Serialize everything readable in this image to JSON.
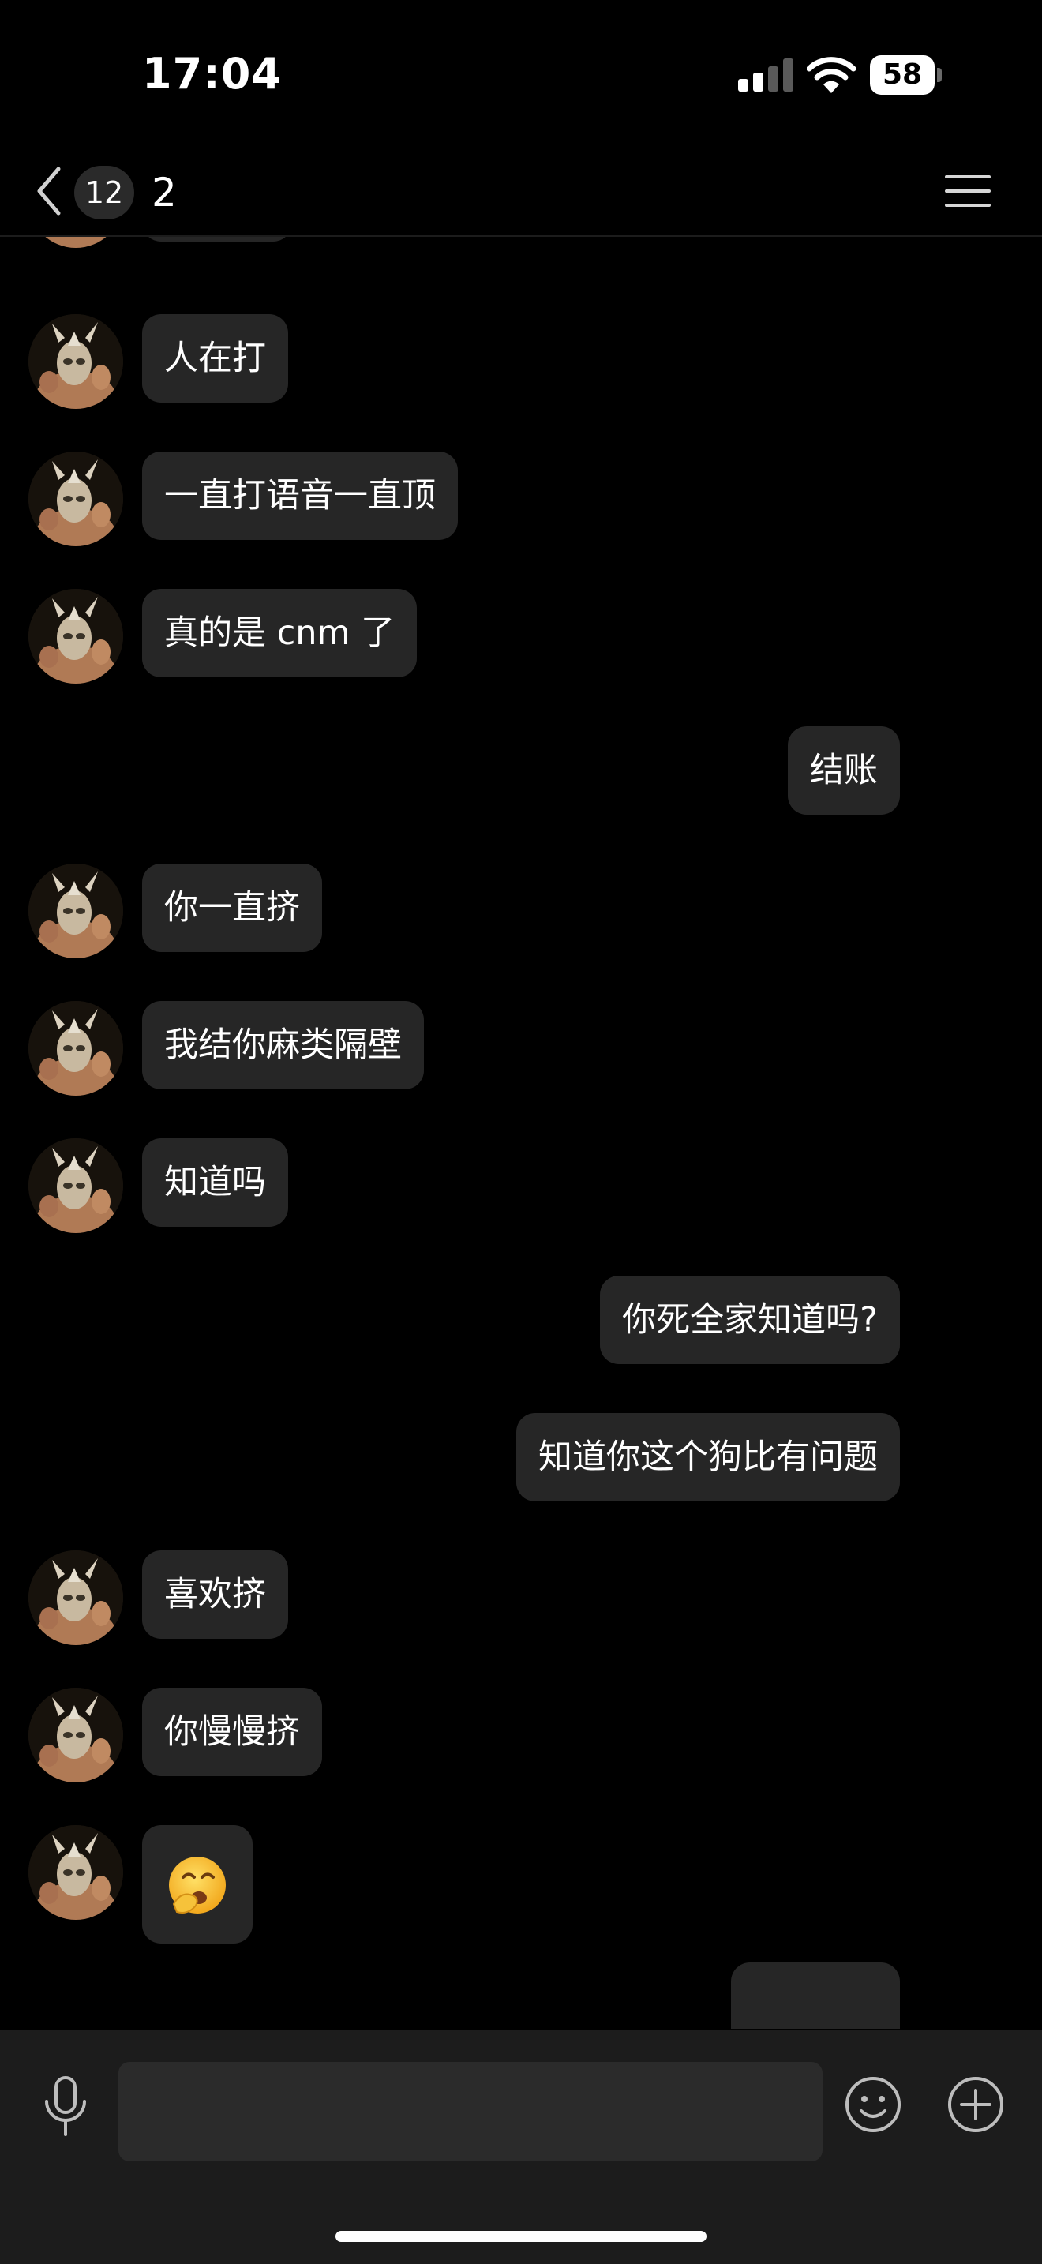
{
  "status_bar": {
    "time": "17:04",
    "battery": "58"
  },
  "header": {
    "unread_count": "12",
    "title": "2"
  },
  "messages": [
    {
      "side": "left",
      "text": ""
    },
    {
      "side": "left",
      "text": "人在打"
    },
    {
      "side": "left",
      "text": "一直打语音一直顶"
    },
    {
      "side": "left",
      "text": "真的是 cnm 了"
    },
    {
      "side": "right",
      "text": "结账"
    },
    {
      "side": "left",
      "text": "你一直挤"
    },
    {
      "side": "left",
      "text": "我结你麻类隔壁"
    },
    {
      "side": "left",
      "text": "知道吗"
    },
    {
      "side": "right",
      "text": "你死全家知道吗?"
    },
    {
      "side": "right",
      "text": "知道你这个狗比有问题"
    },
    {
      "side": "left",
      "text": "喜欢挤"
    },
    {
      "side": "left",
      "text": "你慢慢挤"
    },
    {
      "side": "left",
      "text": "",
      "emoji": "yawning-face"
    },
    {
      "side": "right",
      "text": ""
    }
  ],
  "composer": {
    "placeholder": ""
  },
  "colors": {
    "background": "#000000",
    "bubble": "#262626",
    "composer": "#1c1c1c",
    "input": "#2b2b2b"
  },
  "icons": [
    "back-chevron-icon",
    "menu-icon",
    "microphone-icon",
    "emoji-icon",
    "plus-icon",
    "signal-icon",
    "wifi-icon",
    "battery-icon"
  ]
}
